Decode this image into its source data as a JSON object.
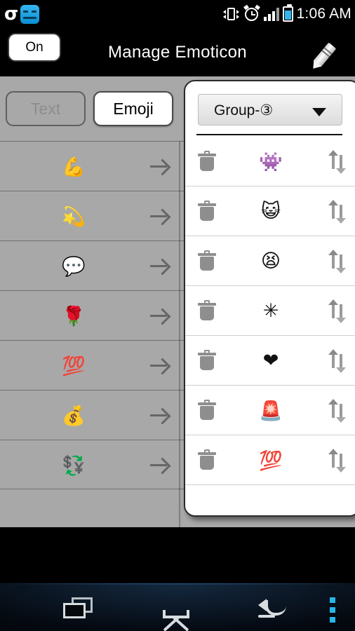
{
  "statusbar": {
    "app_icon": "sigma-glyph",
    "face_icon": "blue-face-icon",
    "vibrate_icon": "vibrate-icon",
    "alarm_icon": "alarm-clock-icon",
    "signal_icon": "signal-bars-icon",
    "battery_icon": "battery-icon",
    "time": "1:06 AM",
    "battery_color": "#32b6ec"
  },
  "actionbar": {
    "toggle_label": "On",
    "title": "Manage Emoticon",
    "edit_icon": "pencil-icon"
  },
  "tabs": [
    {
      "label": "Text",
      "active": false
    },
    {
      "label": "Emoji",
      "active": true
    }
  ],
  "left_list": {
    "arrow_icon": "arrow-right-icon",
    "items": [
      {
        "glyph": "💪",
        "name": "flexed-biceps"
      },
      {
        "glyph": "💫",
        "name": "dizzy-symbol"
      },
      {
        "glyph": "💬",
        "name": "speech-balloon"
      },
      {
        "glyph": "🌹",
        "name": "rose"
      },
      {
        "glyph": "💯",
        "name": "hundred-points"
      },
      {
        "glyph": "💰",
        "name": "money-bag"
      },
      {
        "glyph": "💱",
        "name": "currency-exchange"
      }
    ]
  },
  "panel": {
    "group_label": "Group-③",
    "caret_icon": "chevron-down-icon",
    "delete_icon": "trash-icon",
    "reorder_icon": "reorder-updown-icon",
    "rows": [
      {
        "glyph": "👾",
        "name": "grinning-face"
      },
      {
        "glyph": "😺",
        "name": "smiling-face"
      },
      {
        "glyph": "😫",
        "name": "tired-face"
      },
      {
        "glyph": "✳",
        "name": "eight-spoked-asterisk"
      },
      {
        "glyph": "❤",
        "name": "heavy-black-heart"
      },
      {
        "glyph": "🚨",
        "name": "police-car-light"
      },
      {
        "glyph": "💯",
        "name": "hundred-points"
      }
    ]
  },
  "navbar": {
    "recents_label": "recents-icon",
    "home_label": "home-icon",
    "back_label": "back-icon",
    "menu_label": "overflow-menu-icon",
    "menu_color": "#29b6e8"
  }
}
